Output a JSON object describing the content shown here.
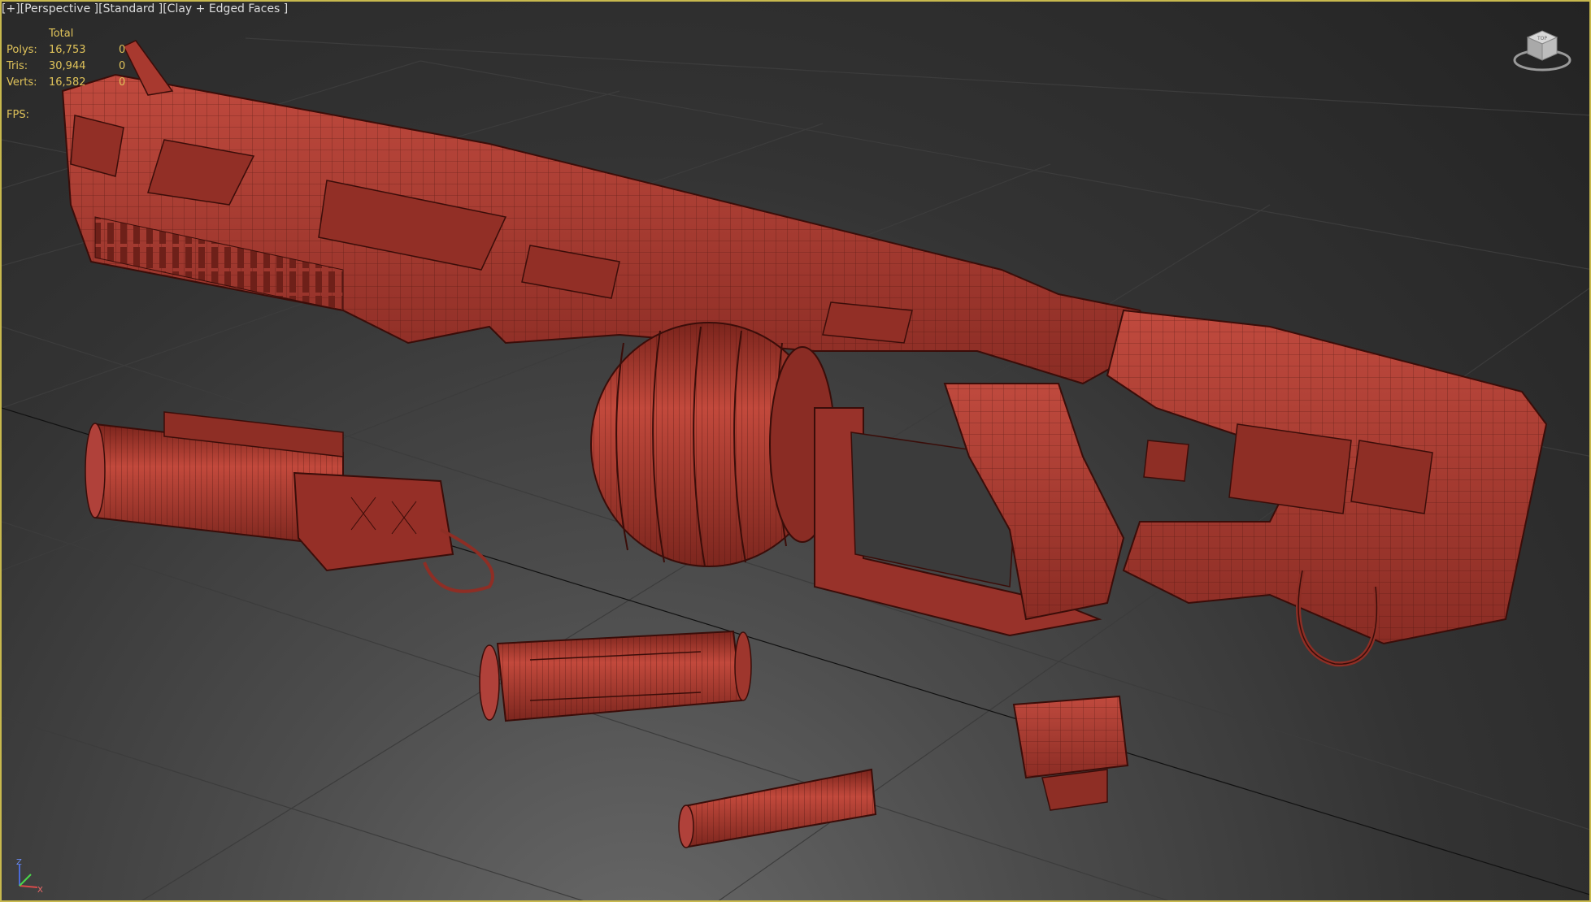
{
  "viewport": {
    "menu_plus": "[+]",
    "view_mode": "[Perspective ]",
    "shading_mode": "[Standard ]",
    "display_mode": "[Clay + Edged Faces ]"
  },
  "stats": {
    "header": "Total",
    "rows": [
      {
        "label": "Polys:",
        "total": "16,753",
        "selected": "0"
      },
      {
        "label": "Tris:",
        "total": "30,944",
        "selected": "0"
      },
      {
        "label": "Verts:",
        "total": "16,582",
        "selected": "0"
      }
    ],
    "fps_label": "FPS:"
  },
  "viewcube": {
    "face_label": "TOP"
  },
  "axis": {
    "z": "Z",
    "x": "X"
  },
  "colors": {
    "clay": "#a8392f",
    "clay_dark": "#6e2019",
    "wire": "#3a0d09",
    "stats_text": "#e0c35a",
    "border": "#c8b94e"
  }
}
